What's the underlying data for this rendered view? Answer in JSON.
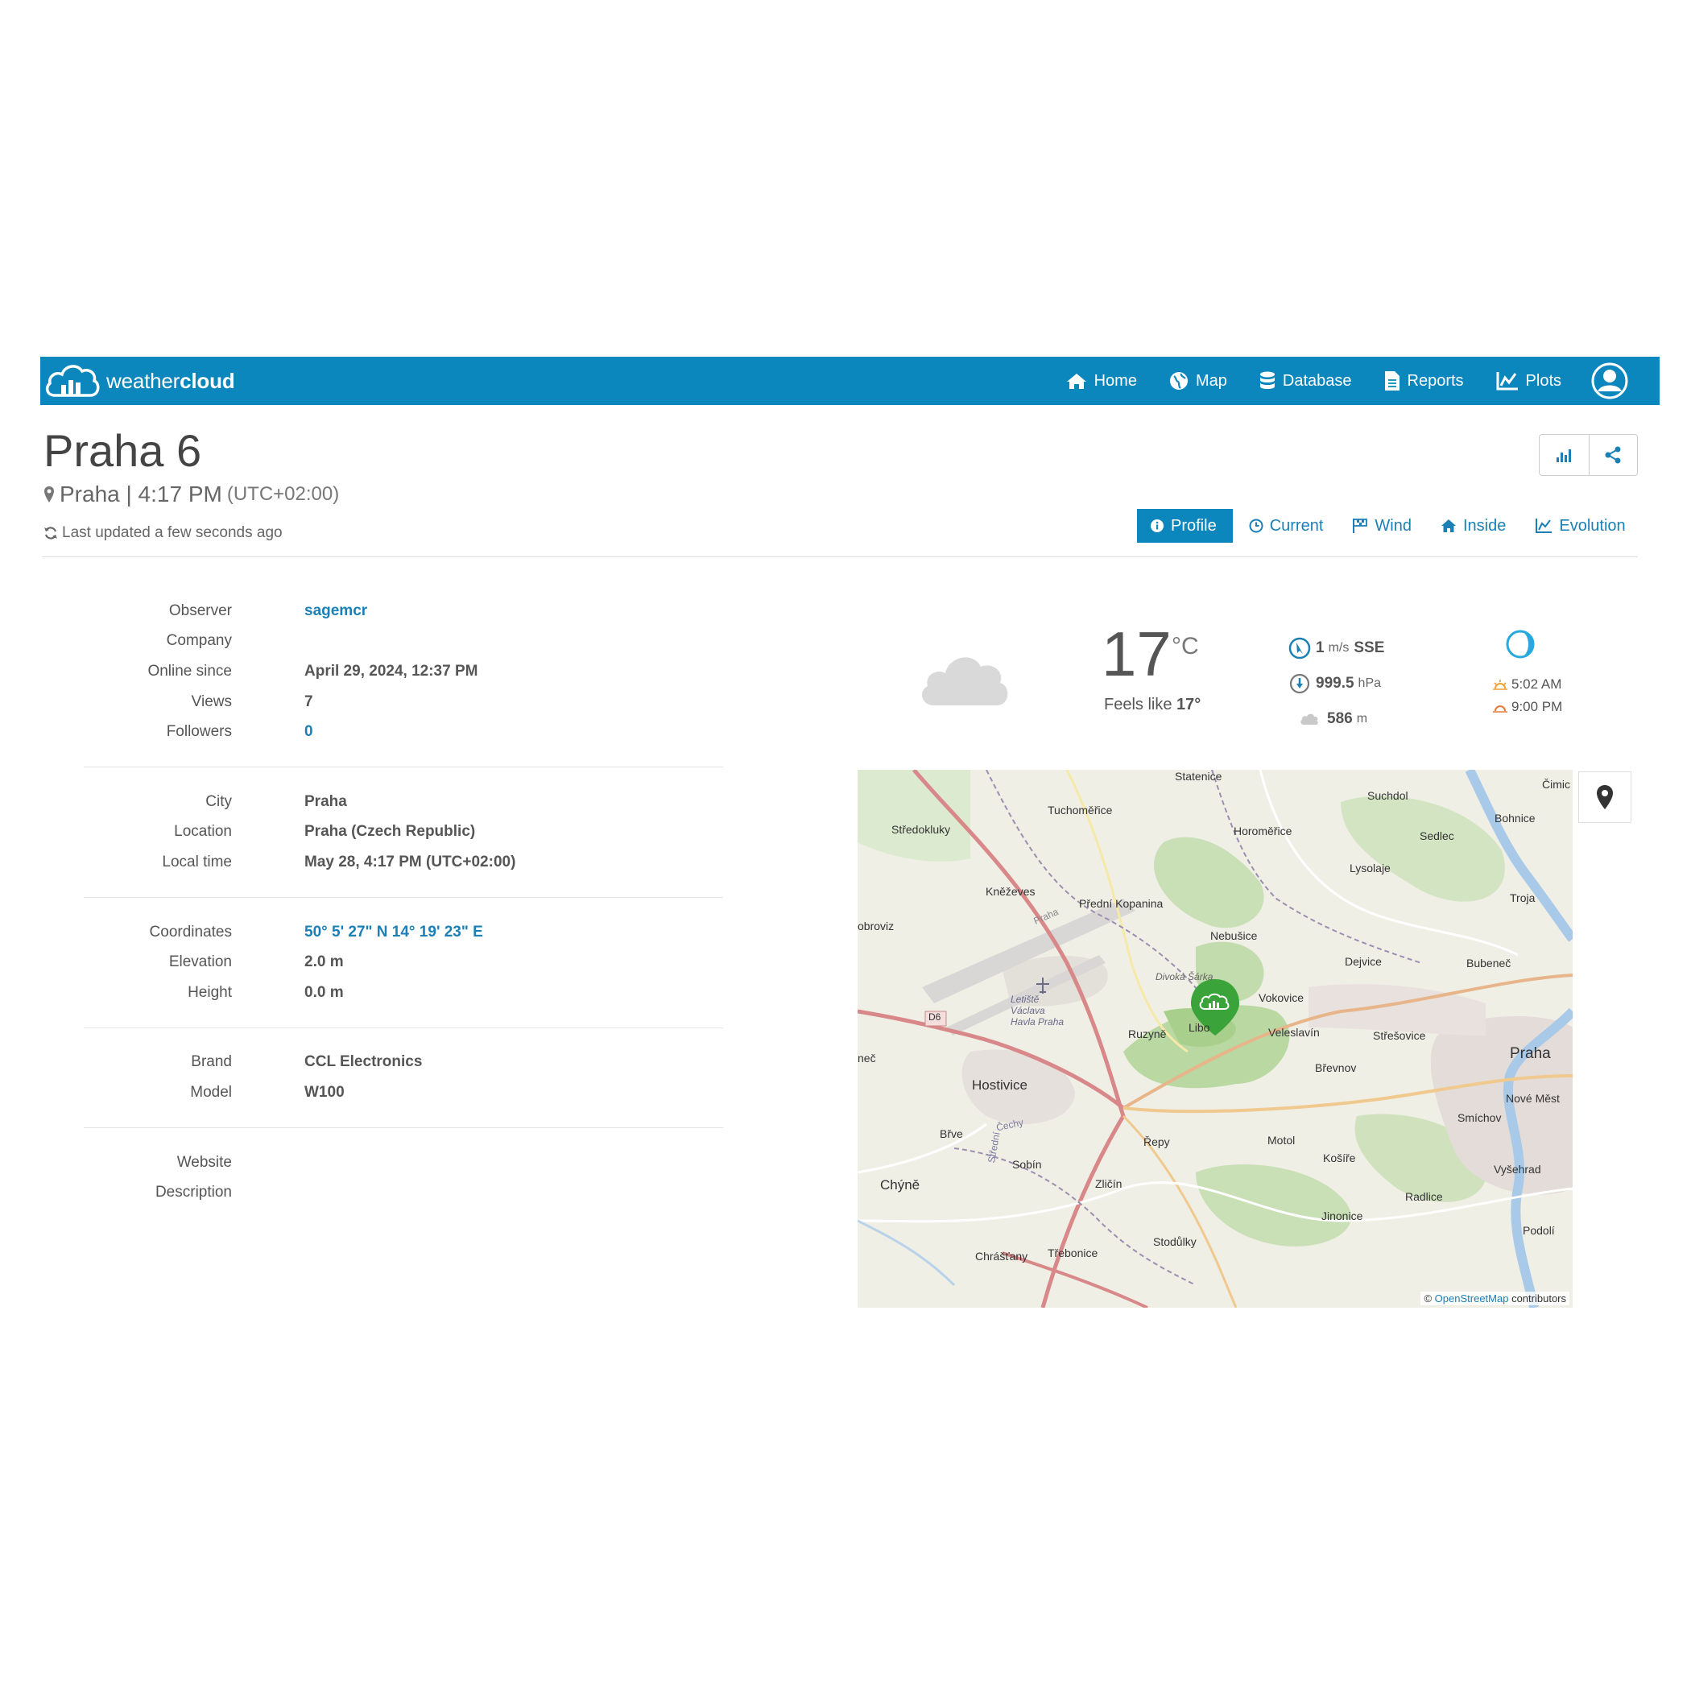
{
  "brand": {
    "name_light": "weather",
    "name_bold": "cloud"
  },
  "nav": {
    "items": [
      {
        "label": "Home",
        "icon": "home-icon"
      },
      {
        "label": "Map",
        "icon": "globe-icon"
      },
      {
        "label": "Database",
        "icon": "database-icon"
      },
      {
        "label": "Reports",
        "icon": "document-icon"
      },
      {
        "label": "Plots",
        "icon": "line-chart-icon"
      }
    ],
    "user_icon": "user-icon"
  },
  "station": {
    "title": "Praha 6",
    "city_time": "Praha | 4:17 PM",
    "timezone": "(UTC+02:00)",
    "last_updated": "Last updated a few seconds ago"
  },
  "tabs": [
    {
      "label": "Profile",
      "icon": "info-icon",
      "active": true
    },
    {
      "label": "Current",
      "icon": "clock-icon"
    },
    {
      "label": "Wind",
      "icon": "flag-icon"
    },
    {
      "label": "Inside",
      "icon": "home-icon"
    },
    {
      "label": "Evolution",
      "icon": "line-chart-icon"
    }
  ],
  "info": {
    "group1": [
      {
        "label": "Observer",
        "value": "sagemcr",
        "link": true
      },
      {
        "label": "Company",
        "value": ""
      },
      {
        "label": "Online since",
        "value": "April 29, 2024, 12:37 PM"
      },
      {
        "label": "Views",
        "value": "7"
      },
      {
        "label": "Followers",
        "value": "0",
        "link": true
      }
    ],
    "group2": [
      {
        "label": "City",
        "value": "Praha"
      },
      {
        "label": "Location",
        "value": "Praha (Czech Republic)"
      },
      {
        "label": "Local time",
        "value": "May 28, 4:17 PM (UTC+02:00)"
      }
    ],
    "group3": [
      {
        "label": "Coordinates",
        "value": "50° 5' 27\" N  14° 19' 23\" E",
        "link": true
      },
      {
        "label": "Elevation",
        "value": "2.0 m"
      },
      {
        "label": "Height",
        "value": "0.0 m"
      }
    ],
    "group4": [
      {
        "label": "Brand",
        "value": "CCL Electronics"
      },
      {
        "label": "Model",
        "value": "W100"
      }
    ],
    "group5": [
      {
        "label": "Website",
        "value": ""
      },
      {
        "label": "Description",
        "value": ""
      }
    ]
  },
  "weather": {
    "temperature": "17",
    "temp_unit": "°C",
    "feels_like_label": "Feels like",
    "feels_like_value": "17°",
    "wind_value": "1",
    "wind_unit": "m/s",
    "wind_dir": "SSE",
    "pressure_value": "999.5",
    "pressure_unit": "hPa",
    "cloud_base_value": "586",
    "cloud_base_unit": "m",
    "sunrise": "5:02 AM",
    "sunset": "9:00 PM",
    "condition_icon": "cloud-icon",
    "moon_icon": "moon-phase-icon"
  },
  "map": {
    "labels": [
      "Statenice",
      "Suchdol",
      "Čimic",
      "Tuchoměřice",
      "Středokluky",
      "Horoměřice",
      "Bohnice",
      "Sedlec",
      "Lysolaje",
      "Troja",
      "Kněževes",
      "Přední Kopanina",
      "obroviz",
      "Nebušice",
      "Dejvice",
      "Bubeneč",
      "Divoká Šárka",
      "Vokovice",
      "Letiště Václava Havla Praha",
      "D6",
      "Ruzyně",
      "Libo",
      "Veleslavín",
      "Střešovice",
      "Praha",
      "neč",
      "Břevnov",
      "Hostivice",
      "Nové Měst",
      "Smíchov",
      "Břve",
      "Motol",
      "Řepy",
      "Košíře",
      "Sobín",
      "Vyšehrad",
      "Chýně",
      "Zličín",
      "Radlice",
      "Jinonice",
      "Podolí",
      "Chrášťany",
      "Třebonice",
      "Stodůlky",
      "Praha",
      "Čechy",
      "Střední"
    ],
    "attribution_prefix": "©",
    "attribution_link": "OpenStreetMap",
    "attribution_suffix": "contributors"
  }
}
